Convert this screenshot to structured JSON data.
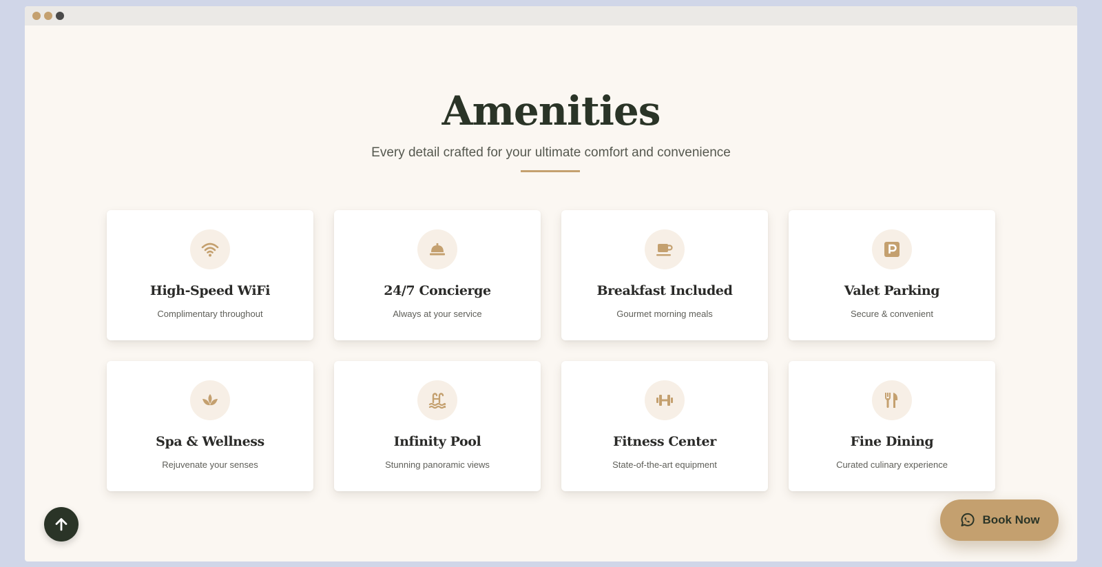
{
  "section": {
    "title": "Amenities",
    "subtitle": "Every detail crafted for your ultimate comfort and convenience"
  },
  "amenities": [
    {
      "icon": "wifi-icon",
      "title": "High-Speed WiFi",
      "description": "Complimentary throughout"
    },
    {
      "icon": "concierge-bell-icon",
      "title": "24/7 Concierge",
      "description": "Always at your service"
    },
    {
      "icon": "coffee-cup-icon",
      "title": "Breakfast Included",
      "description": "Gourmet morning meals"
    },
    {
      "icon": "parking-icon",
      "title": "Valet Parking",
      "description": "Secure & convenient"
    },
    {
      "icon": "lotus-icon",
      "title": "Spa & Wellness",
      "description": "Rejuvenate your senses"
    },
    {
      "icon": "swimming-pool-icon",
      "title": "Infinity Pool",
      "description": "Stunning panoramic views"
    },
    {
      "icon": "dumbbell-icon",
      "title": "Fitness Center",
      "description": "State-of-the-art equipment"
    },
    {
      "icon": "utensils-icon",
      "title": "Fine Dining",
      "description": "Curated culinary experience"
    }
  ],
  "actions": {
    "book_now_label": "Book Now",
    "book_now_icon": "whatsapp-icon",
    "scroll_top_icon": "arrow-up-icon"
  },
  "colors": {
    "accent": "#c4a06f",
    "dark": "#2a3427",
    "background": "#fbf7f2",
    "icon_bg": "#f7efe6"
  }
}
